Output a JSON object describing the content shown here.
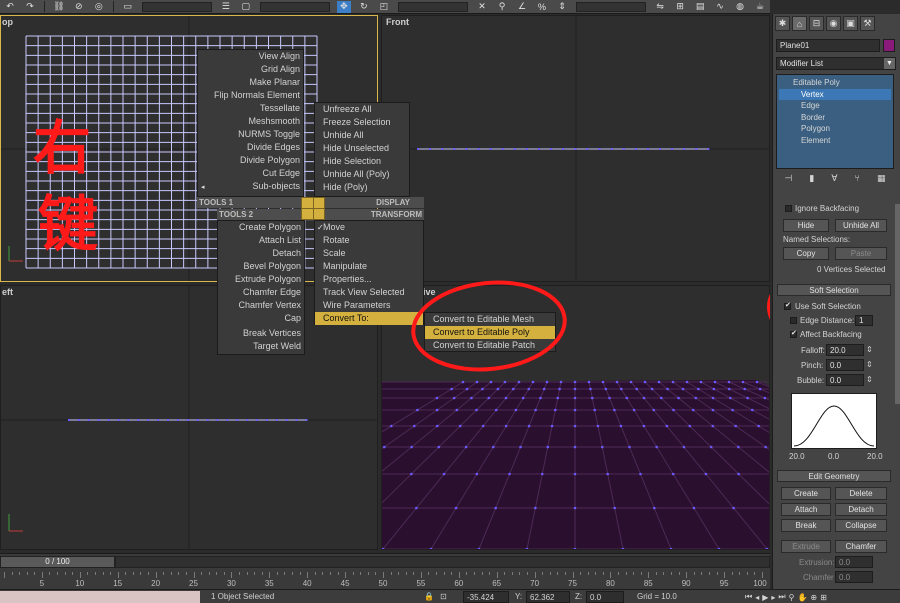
{
  "viewports": {
    "top": "op",
    "front": "Front",
    "left": "eft",
    "perspective": "tive"
  },
  "quad_menu": {
    "tools1_left": [
      "View Align",
      "Grid Align",
      "Make Planar",
      "Flip Normals Element",
      "Tessellate",
      "Meshsmooth",
      "NURMS Toggle",
      "Divide Edges",
      "Divide Polygon",
      "Cut Edge",
      "Sub-objects"
    ],
    "display_right": [
      "Unfreeze All",
      "Freeze Selection",
      "Unhide All",
      "Hide Unselected",
      "Hide Selection",
      "Unhide All (Poly)",
      "Hide (Poly)"
    ],
    "headers": {
      "tools1": "TOOLS 1",
      "display": "DISPLAY",
      "tools2": "TOOLS 2",
      "transform": "TRANSFORM"
    },
    "tools2_left": [
      "Create Polygon",
      "Attach List",
      "Detach",
      "Bevel Polygon",
      "Extrude Polygon",
      "Chamfer Edge",
      "Chamfer Vertex",
      "Cap",
      "Break Vertices",
      "Target Weld"
    ],
    "transform_right": [
      "Move",
      "Rotate",
      "Scale",
      "Manipulate",
      "Properties...",
      "Track View Selected",
      "Wire Parameters",
      "Convert To:"
    ],
    "convert_submenu": [
      "Convert to Editable Mesh",
      "Convert to Editable Poly",
      "Convert to Editable Patch"
    ],
    "highlight_color": "#d4b03e"
  },
  "command_panel": {
    "object_name": "Plane01",
    "object_color": "#8a1a7a",
    "modifier_list": "Modifier List",
    "stack": [
      "Editable Poly",
      "Vertex",
      "Edge",
      "Border",
      "Polygon",
      "Element"
    ],
    "ignore_backfacing": "Ignore Backfacing",
    "hide": "Hide",
    "unhide_all": "Unhide All",
    "named_selections": "Named Selections:",
    "copy": "Copy",
    "paste": "Paste",
    "vertices_selected": "0 Vertices Selected",
    "soft_selection": "Soft Selection",
    "use_soft_selection": "Use Soft Selection",
    "edge_distance": "Edge Distance:",
    "edge_distance_value": "1",
    "affect_backfacing": "Affect Backfacing",
    "falloff": "Falloff:",
    "falloff_value": "20.0",
    "pinch": "Pinch:",
    "pinch_value": "0.0",
    "bubble": "Bubble:",
    "bubble_value": "0.0",
    "curve_min": "20.0",
    "curve_mid": "0.0",
    "curve_max": "20.0",
    "edit_geometry": "Edit Geometry",
    "create": "Create",
    "delete": "Delete",
    "attach": "Attach",
    "detach": "Detach",
    "break": "Break",
    "collapse": "Collapse",
    "extrude": "Extrude",
    "chamfer": "Chamfer",
    "extrusion": "Extrusion:",
    "chamfer_field": "Chamfer",
    "zero_value": "0.0"
  },
  "timeline": {
    "slider": "0 / 100",
    "ticks": [
      "5",
      "10",
      "15",
      "20",
      "25",
      "30",
      "35",
      "40",
      "45",
      "50",
      "55",
      "60",
      "65",
      "70",
      "75",
      "80",
      "85",
      "90",
      "95",
      "100"
    ]
  },
  "status": {
    "selected": "1 Object Selected",
    "x_value": "-35.424",
    "y_label": "Y:",
    "y_value": "62.362",
    "z_label": "Z:",
    "z_value": "0.0",
    "grid": "Grid = 10.0"
  },
  "annotation_text": "右键",
  "colors": {
    "mesh": "#c8c8ff",
    "vertex": "#6a5aff",
    "persp_bg": "#2b0f2f",
    "annotation": "#ff1a1a"
  }
}
